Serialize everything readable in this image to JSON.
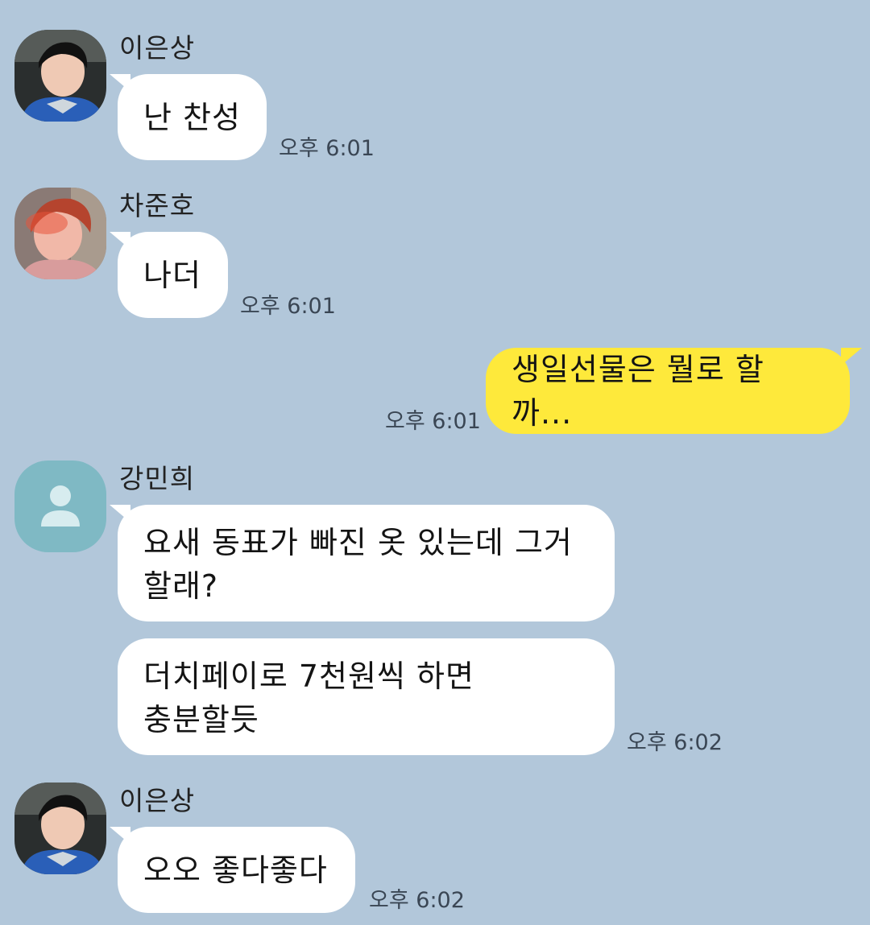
{
  "messages": [
    {
      "sender": "이은상",
      "text": "난 찬성",
      "time": "오후 6:01"
    },
    {
      "sender": "차준호",
      "text": "나더",
      "time": "오후 6:01"
    },
    {
      "sender": "me",
      "text": "생일선물은 뭘로 할까...",
      "time": "오후 6:01"
    },
    {
      "sender": "강민희",
      "lines": [
        "요새 동표가 빠진 옷 있는데 그거",
        "할래?"
      ]
    },
    {
      "lines": [
        "더치페이로 7천원씩 하면",
        "충분할듯"
      ],
      "time": "오후 6:02"
    },
    {
      "sender": "이은상",
      "text": "오오 좋다좋다",
      "time": "오후 6:02"
    }
  ],
  "colors": {
    "background": "#b2c7da",
    "other_bubble": "#ffffff",
    "my_bubble": "#fee93b",
    "default_avatar": "#7fb9c4"
  },
  "icons": {
    "default_avatar": "person-icon"
  }
}
